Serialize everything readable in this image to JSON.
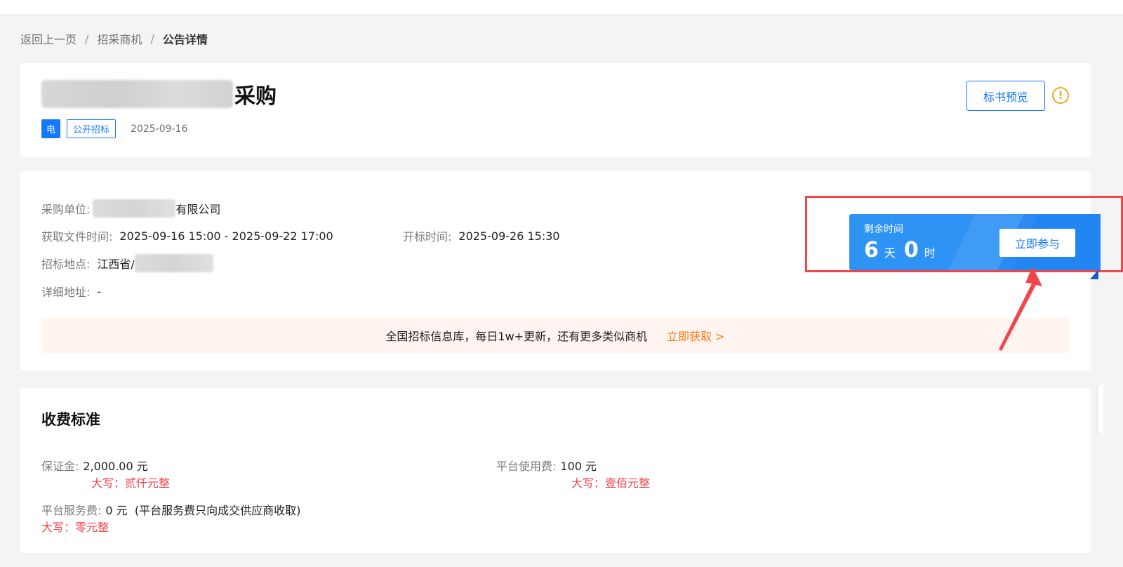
{
  "breadcrumb": {
    "back": "返回上一页",
    "sep": "/",
    "parent": "招采商机",
    "current": "公告详情"
  },
  "header": {
    "title_suffix": "采购",
    "tag_type": "电",
    "tag_method": "公开招标",
    "date": "2025-09-16",
    "preview_button": "标书预览",
    "warn_symbol": "!"
  },
  "info": {
    "buyer_label": "采购单位:",
    "buyer_suffix": "有限公司",
    "doc_time_label": "获取文件时间:",
    "doc_time_value": "2025-09-16 15:00 - 2025-09-22 17:00",
    "open_time_label": "开标时间:",
    "open_time_value": "2025-09-26 15:30",
    "location_label": "招标地点:",
    "location_prefix": "江西省/",
    "address_label": "详细地址:",
    "address_value": "-"
  },
  "banner": {
    "text": "全国招标信息库，每日1w+更新，还有更多类似商机",
    "cta": "立即获取 >"
  },
  "countdown": {
    "label": "剩余时间",
    "days": "6",
    "days_unit": "天",
    "hours": "0",
    "hours_unit": "时",
    "join_button": "立即参与"
  },
  "fees": {
    "title": "收费标准",
    "deposit_label": "保证金:",
    "deposit_value": "2,000.00 元",
    "deposit_caps": "大写：贰仟元整",
    "platform_use_label": "平台使用费:",
    "platform_use_value": "100 元",
    "platform_use_caps": "大写：壹佰元整",
    "service_label": "平台服务费:",
    "service_value": "0 元  (平台服务费只向成交供应商收取)",
    "service_caps": "大写：零元整"
  },
  "colors": {
    "primary": "#1677ff",
    "countdown_bg": "#2f93f5",
    "highlight_red": "#f0454b",
    "cta_orange": "#ff7a1a",
    "warn_orange": "#f5a623"
  }
}
